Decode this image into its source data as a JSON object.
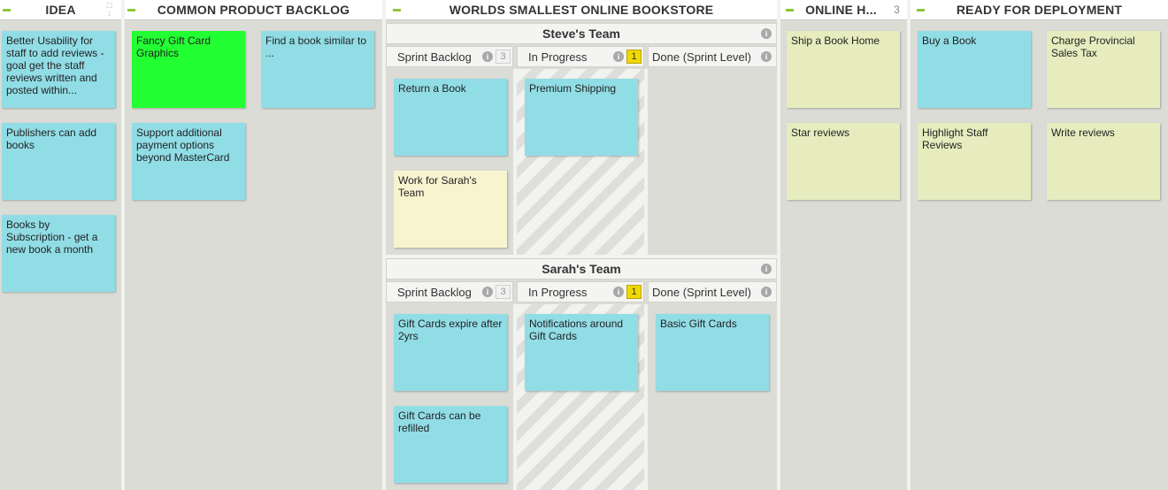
{
  "columns": {
    "idea": {
      "title": "IDEA"
    },
    "backlog": {
      "title": "COMMON PRODUCT BACKLOG"
    },
    "worlds": {
      "title": "WORLDS SMALLEST ONLINE BOOKSTORE"
    },
    "online": {
      "title": "ONLINE H...",
      "count": "3"
    },
    "ready": {
      "title": "READY FOR DEPLOYMENT"
    }
  },
  "idea_cards": [
    "Better Usability for staff to add reviews - goal get the staff reviews written and posted within...",
    "Publishers can add books",
    "Books by Subscription - get a new book a month"
  ],
  "backlog_cards": [
    "Fancy Gift Card Graphics",
    "Find a book similar to ...",
    "Support additional payment options beyond MasterCard"
  ],
  "teams": [
    {
      "name": "Steve's Team",
      "sub": {
        "backlog": "Sprint Backlog",
        "backlog_count": "3",
        "progress": "In Progress",
        "progress_count": "1",
        "done": "Done (Sprint Level)"
      },
      "backlog_cards": [
        "Return a Book",
        "Work for Sarah's Team"
      ],
      "progress_cards": [
        "Premium Shipping"
      ],
      "done_cards": []
    },
    {
      "name": "Sarah's Team",
      "sub": {
        "backlog": "Sprint Backlog",
        "backlog_count": "3",
        "progress": "In Progress",
        "progress_count": "1",
        "done": "Done (Sprint Level)"
      },
      "backlog_cards": [
        "Gift Cards expire after 2yrs",
        "Gift Cards can be refilled"
      ],
      "progress_cards": [
        "Notifications around Gift Cards"
      ],
      "done_cards": [
        "Basic Gift Cards"
      ]
    }
  ],
  "online_cards": [
    "Ship a Book Home",
    "Star reviews"
  ],
  "ready_cards": [
    "Buy a Book",
    "Charge Provincial Sales Tax",
    "Highlight Staff Reviews",
    "Write reviews"
  ],
  "icons": {
    "info": "info-icon",
    "collapse": "collapse-icon",
    "sort": "sort-icon"
  },
  "colors": {
    "card_blue": "#91dde6",
    "card_green": "#22ff33",
    "card_cream": "#f8f4d0",
    "card_pale": "#e6ecbe",
    "collapse": "#8dc63f",
    "wip": "#f0d800"
  }
}
